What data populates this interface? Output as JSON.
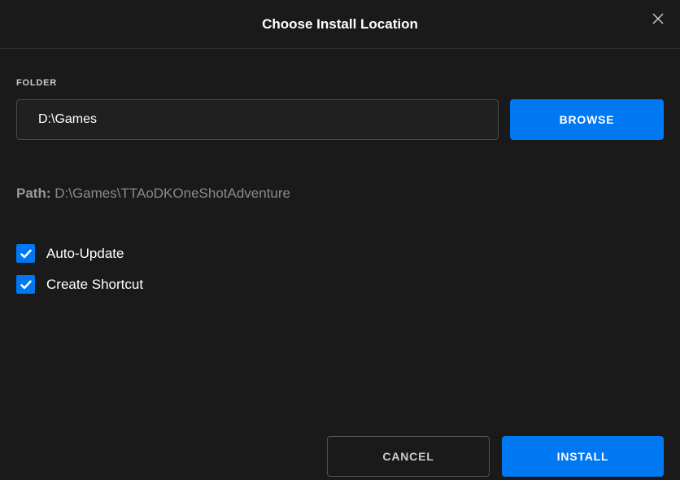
{
  "dialog": {
    "title": "Choose Install Location"
  },
  "folder": {
    "label": "FOLDER",
    "value": "D:\\Games",
    "browse_label": "BROWSE"
  },
  "path": {
    "label": "Path:",
    "value": "D:\\Games\\TTAoDKOneShotAdventure"
  },
  "options": {
    "auto_update": {
      "label": "Auto-Update",
      "checked": true
    },
    "create_shortcut": {
      "label": "Create Shortcut",
      "checked": true
    }
  },
  "actions": {
    "cancel_label": "CANCEL",
    "install_label": "INSTALL"
  }
}
